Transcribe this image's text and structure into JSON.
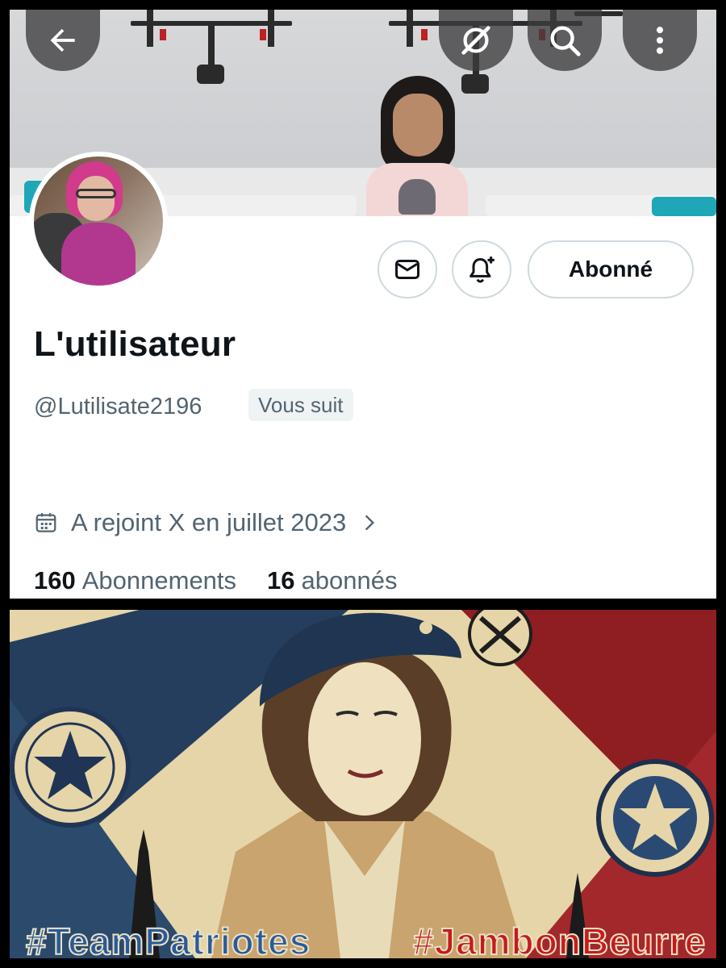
{
  "profile": {
    "display_name": "L'utilisateur",
    "handle": "@Lutilisate2196",
    "follows_you_label": "Vous suit",
    "joined_text": "A rejoint X en juillet 2023",
    "following_count": "160",
    "following_label": "Abonnements",
    "followers_count": "16",
    "followers_label": "abonnés"
  },
  "actions": {
    "follow_state_label": "Abonné",
    "message_icon": "envelope-icon",
    "notify_icon": "bell-plus-icon"
  },
  "header_buttons": [
    "back-arrow-icon",
    "grok-icon",
    "search-icon",
    "more-vertical-icon"
  ],
  "poster": {
    "hashtag_left": "#TeamPatriotes",
    "hashtag_right": "#JambonBeurre"
  },
  "colors": {
    "text_primary": "#0f1419",
    "text_secondary": "#536471",
    "border": "#cfd9de",
    "hashtag_blue": "#2a5a9a",
    "hashtag_red": "#c81a1a"
  }
}
